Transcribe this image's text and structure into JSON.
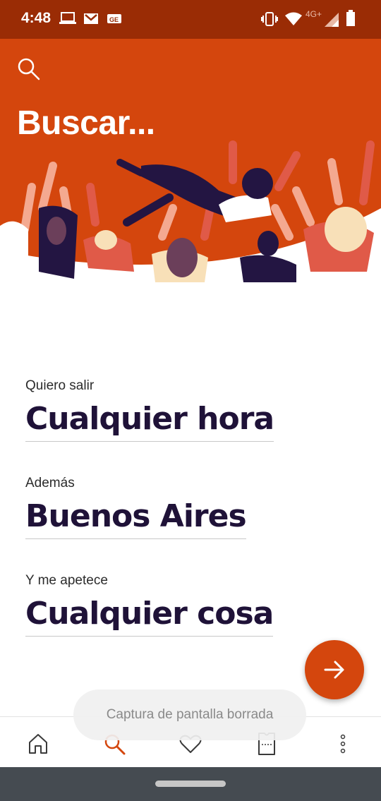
{
  "status_bar": {
    "time": "4:48",
    "left_icons": [
      "laptop-icon",
      "gmail-icon",
      "ge-notification-icon"
    ],
    "network_label": "4G+",
    "right_icons": [
      "vibrate-icon",
      "wifi-icon",
      "signal-icon",
      "battery-icon"
    ]
  },
  "hero": {
    "title": "Buscar...",
    "search_icon": "search-icon",
    "colors": {
      "background": "#d4460d"
    }
  },
  "search_form": {
    "when": {
      "label": "Quiero salir",
      "value": "Cualquier hora"
    },
    "where": {
      "label": "Además",
      "value": "Buenos Aires"
    },
    "what": {
      "label": "Y me apetece",
      "value": "Cualquier cosa"
    }
  },
  "fab": {
    "icon": "arrow-right-icon",
    "color": "#d4460d"
  },
  "bottom_nav": {
    "items": [
      {
        "name": "home",
        "icon": "home-icon",
        "active": false
      },
      {
        "name": "search",
        "icon": "search-icon",
        "active": true
      },
      {
        "name": "favorites",
        "icon": "heart-icon",
        "active": false
      },
      {
        "name": "tickets",
        "icon": "ticket-icon",
        "active": false
      },
      {
        "name": "more",
        "icon": "more-vertical-icon",
        "active": false
      }
    ],
    "active_color": "#d4460d"
  },
  "toast": {
    "text": "Captura de pantalla borrada"
  }
}
